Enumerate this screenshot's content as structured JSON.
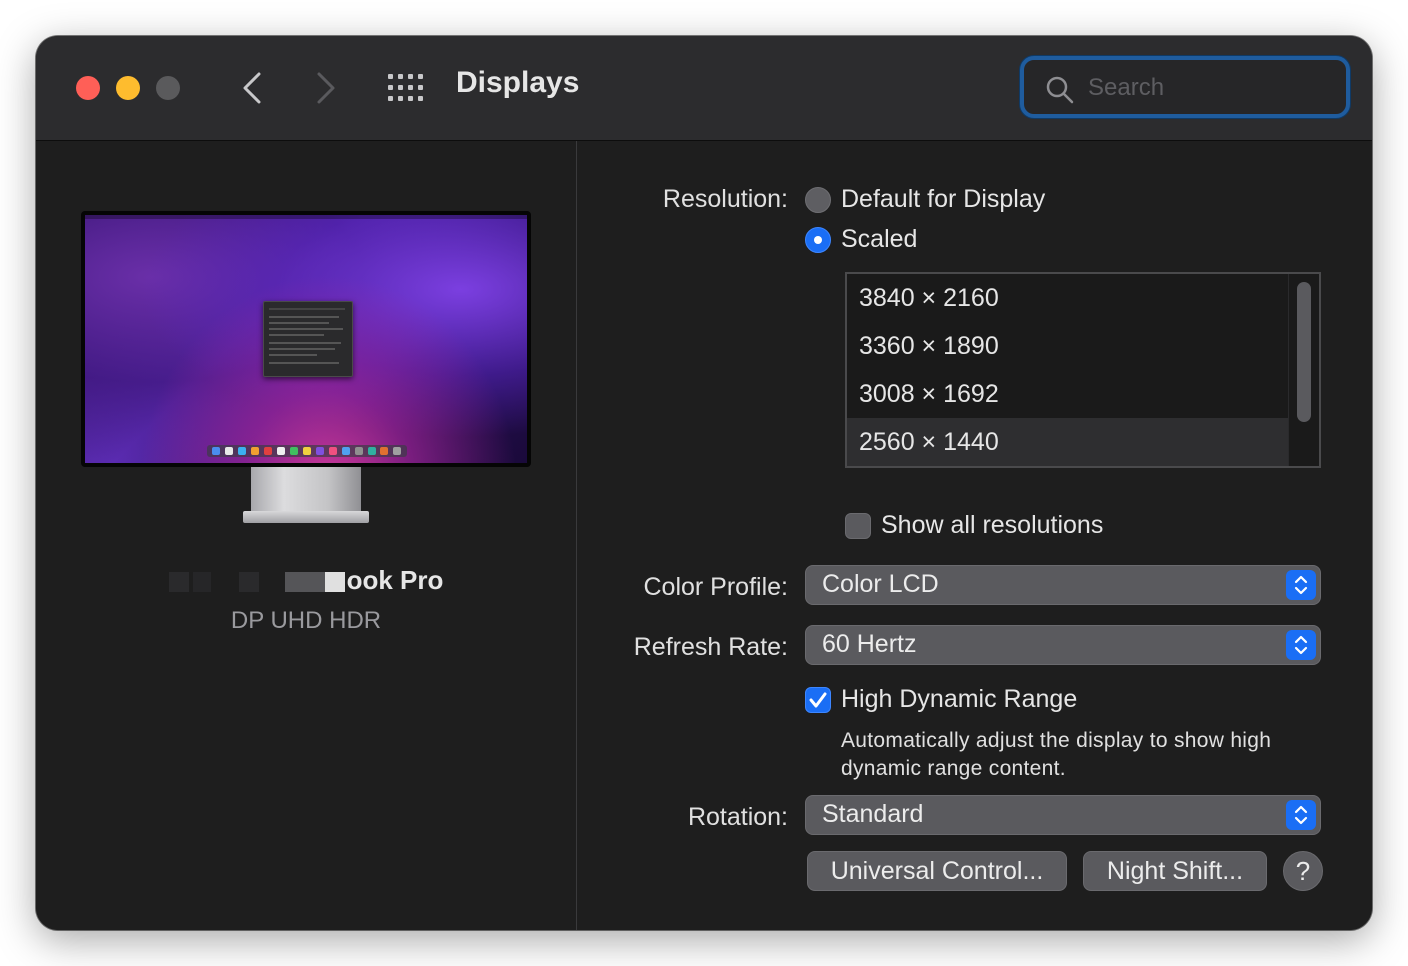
{
  "window": {
    "title": "Displays",
    "search_placeholder": "Search"
  },
  "sidebar": {
    "display_name_visible": "ook Pro",
    "display_subtitle": "DP UHD HDR"
  },
  "resolution": {
    "label": "Resolution:",
    "option_default": "Default for Display",
    "option_scaled": "Scaled",
    "selected_option": "Scaled",
    "list": [
      "3840 × 2160",
      "3360 × 1890",
      "3008 × 1692",
      "2560 × 1440"
    ],
    "selected_resolution": "2560 × 1440",
    "show_all_label": "Show all resolutions",
    "show_all_checked": false
  },
  "color_profile": {
    "label": "Color Profile:",
    "value": "Color LCD"
  },
  "refresh_rate": {
    "label": "Refresh Rate:",
    "value": "60 Hertz"
  },
  "hdr": {
    "label": "High Dynamic Range",
    "checked": true,
    "description": "Automatically adjust the display to show high dynamic range content."
  },
  "rotation": {
    "label": "Rotation:",
    "value": "Standard"
  },
  "buttons": {
    "universal_control": "Universal Control...",
    "night_shift": "Night Shift...",
    "help": "?"
  },
  "colors": {
    "accent": "#1a6ef5",
    "close": "#ff5f57",
    "minimize": "#febc2e",
    "zoom_disabled": "#5a5a5c",
    "window_bg": "#1e1e1e",
    "titlebar_bg": "#2c2c2e"
  },
  "icons": {
    "back": "chevron-left-icon",
    "forward": "chevron-right-icon",
    "show_all": "grid-icon",
    "search": "magnifier-icon",
    "popup": "up-down-chevron-icon",
    "checkmark": "checkmark-icon"
  }
}
